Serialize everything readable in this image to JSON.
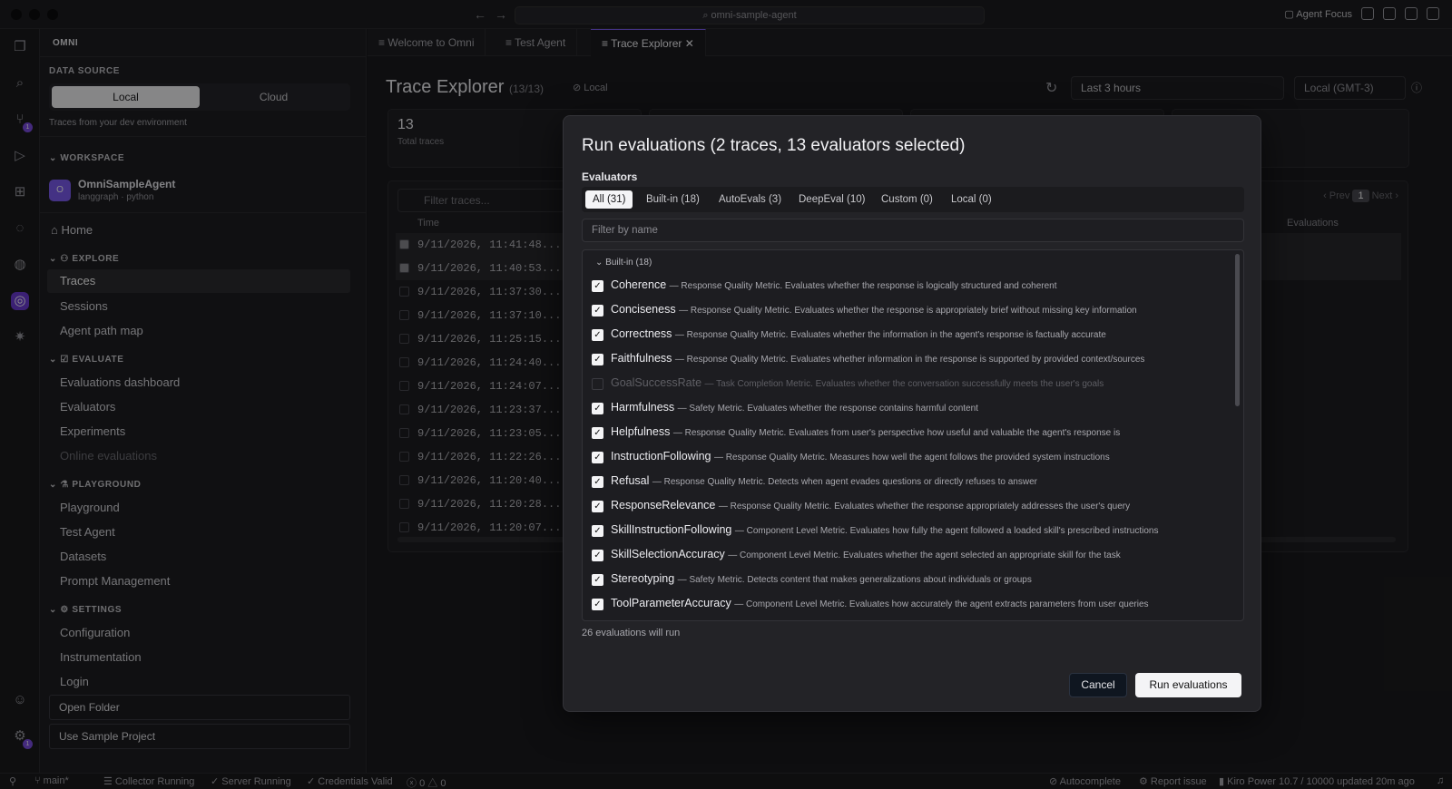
{
  "window": {
    "search": "omni-sample-agent",
    "agent_focus": "Agent Focus"
  },
  "sidebar": {
    "title": "OMNI",
    "data_source": {
      "label": "DATA SOURCE",
      "options": [
        "Local",
        "Cloud"
      ],
      "selected": "Local",
      "description": "Traces from your dev environment"
    },
    "workspace": {
      "label": "WORKSPACE",
      "avatar": "O",
      "name": "OmniSampleAgent",
      "sub": "langgraph · python"
    },
    "home": "Home",
    "explore": {
      "label": "EXPLORE",
      "items": [
        "Traces",
        "Sessions",
        "Agent path map"
      ]
    },
    "evaluate": {
      "label": "EVALUATE",
      "items": [
        "Evaluations dashboard",
        "Evaluators",
        "Experiments",
        "Online evaluations"
      ]
    },
    "playground": {
      "label": "PLAYGROUND",
      "items": [
        "Playground",
        "Test Agent",
        "Datasets",
        "Prompt Management"
      ]
    },
    "settings": {
      "label": "SETTINGS",
      "items": [
        "Configuration",
        "Instrumentation",
        "Login"
      ]
    },
    "buttons": {
      "open_folder": "Open Folder",
      "use_sample": "Use Sample Project"
    }
  },
  "tabs": [
    "Welcome to Omni",
    "Test Agent",
    "Trace Explorer"
  ],
  "trace_explorer": {
    "title": "Trace Explorer",
    "count": "(13/13)",
    "source": "Local",
    "range": "Last 3 hours",
    "timezone": "Local (GMT-3)",
    "total": "13",
    "total_label": "Total traces",
    "filter_placeholder": "Filter traces...",
    "col_time": "Time",
    "col_eval": "Evaluations",
    "pager": {
      "prev": "‹ Prev",
      "page": "1",
      "next": "Next ›"
    },
    "rows": [
      "9/11/2026, 11:41:48...",
      "9/11/2026, 11:40:53...",
      "9/11/2026, 11:37:30...",
      "9/11/2026, 11:37:10...",
      "9/11/2026, 11:25:15...",
      "9/11/2026, 11:24:40...",
      "9/11/2026, 11:24:07...",
      "9/11/2026, 11:23:37...",
      "9/11/2026, 11:23:05...",
      "9/11/2026, 11:22:26...",
      "9/11/2026, 11:20:40...",
      "9/11/2026, 11:20:28...",
      "9/11/2026, 11:20:07..."
    ]
  },
  "modal": {
    "title": "Run evaluations (2 traces, 13 evaluators selected)",
    "evaluators_label": "Evaluators",
    "tabs": [
      "All (31)",
      "Built-in (18)",
      "AutoEvals (3)",
      "DeepEval (10)",
      "Custom (0)",
      "Local (0)"
    ],
    "filter_placeholder": "Filter by name",
    "group": "Built-in (18)",
    "items": [
      {
        "name": "Coherence",
        "desc": "— Response Quality Metric. Evaluates whether the response is logically structured and coherent",
        "checked": true
      },
      {
        "name": "Conciseness",
        "desc": "— Response Quality Metric. Evaluates whether the response is appropriately brief without missing key information",
        "checked": true
      },
      {
        "name": "Correctness",
        "desc": "— Response Quality Metric. Evaluates whether the information in the agent's response is factually accurate",
        "checked": true
      },
      {
        "name": "Faithfulness",
        "desc": "— Response Quality Metric. Evaluates whether information in the response is supported by provided context/sources",
        "checked": true
      },
      {
        "name": "GoalSuccessRate",
        "desc": "— Task Completion Metric. Evaluates whether the conversation successfully meets the user's goals",
        "checked": false
      },
      {
        "name": "Harmfulness",
        "desc": "— Safety Metric. Evaluates whether the response contains harmful content",
        "checked": true
      },
      {
        "name": "Helpfulness",
        "desc": "— Response Quality Metric. Evaluates from user's perspective how useful and valuable the agent's response is",
        "checked": true
      },
      {
        "name": "InstructionFollowing",
        "desc": "— Response Quality Metric. Measures how well the agent follows the provided system instructions",
        "checked": true
      },
      {
        "name": "Refusal",
        "desc": "— Response Quality Metric. Detects when agent evades questions or directly refuses to answer",
        "checked": true
      },
      {
        "name": "ResponseRelevance",
        "desc": "— Response Quality Metric. Evaluates whether the response appropriately addresses the user's query",
        "checked": true
      },
      {
        "name": "SkillInstructionFollowing",
        "desc": "— Component Level Metric. Evaluates how fully the agent followed a loaded skill's prescribed instructions",
        "checked": true
      },
      {
        "name": "SkillSelectionAccuracy",
        "desc": "— Component Level Metric. Evaluates whether the agent selected an appropriate skill for the task",
        "checked": true
      },
      {
        "name": "Stereotyping",
        "desc": "— Safety Metric. Detects content that makes generalizations about individuals or groups",
        "checked": true
      },
      {
        "name": "ToolParameterAccuracy",
        "desc": "— Component Level Metric. Evaluates how accurately the agent extracts parameters from user queries",
        "checked": true
      }
    ],
    "run_count": "26 evaluations will run",
    "cancel": "Cancel",
    "run": "Run evaluations"
  },
  "statusbar": {
    "branch": "main*",
    "collector": "Collector Running",
    "server": "Server Running",
    "credentials": "Credentials Valid",
    "problems": "0",
    "warnings": "0",
    "autocomplete": "Autocomplete",
    "report": "Report issue",
    "power": "Kiro Power 10.7 / 10000 updated 20m ago"
  }
}
